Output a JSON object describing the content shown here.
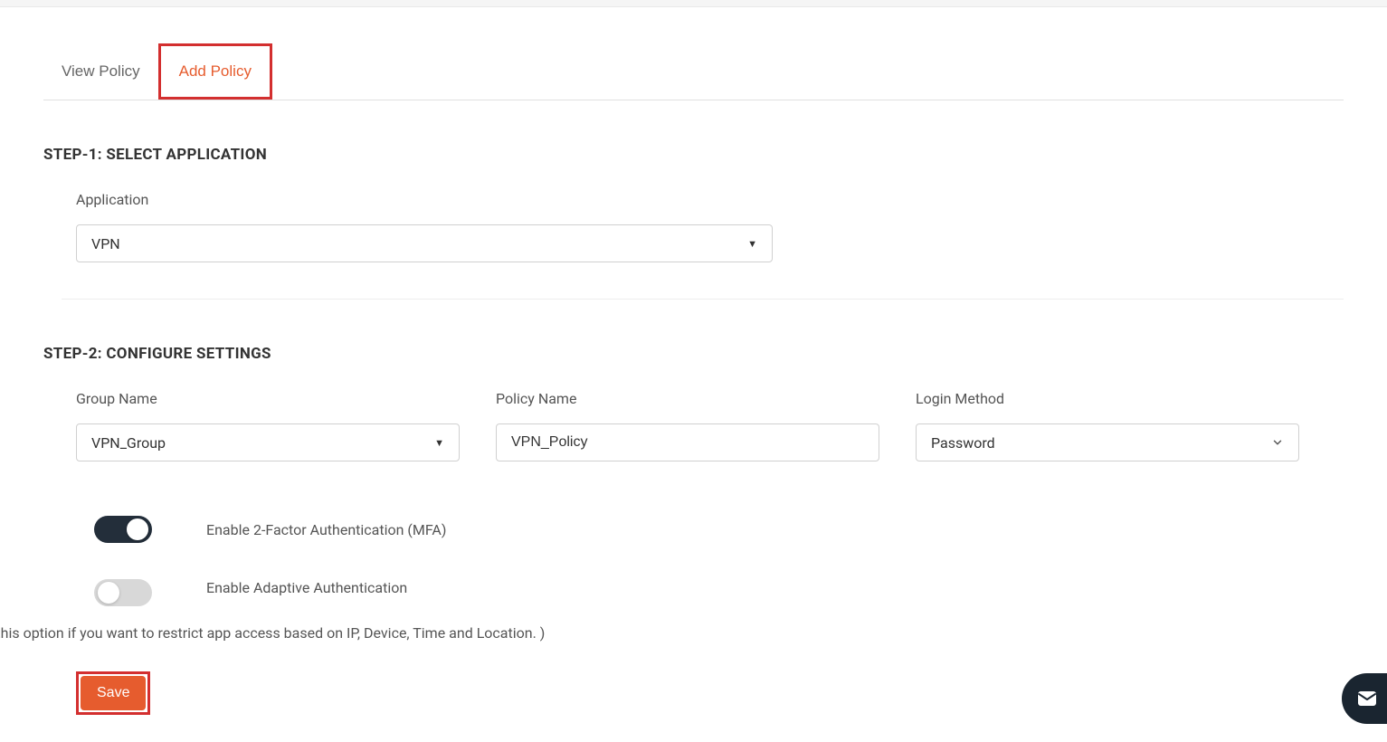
{
  "tabs": {
    "view_policy": "View Policy",
    "add_policy": "Add Policy"
  },
  "step1": {
    "title": "STEP-1: SELECT APPLICATION",
    "application_label": "Application",
    "application_value": "VPN"
  },
  "step2": {
    "title": "STEP-2: CONFIGURE SETTINGS",
    "group_name_label": "Group Name",
    "group_name_value": "VPN_Group",
    "policy_name_label": "Policy Name",
    "policy_name_value": "VPN_Policy",
    "login_method_label": "Login Method",
    "login_method_value": "Password"
  },
  "toggles": {
    "mfa_label": "Enable 2-Factor Authentication (MFA)",
    "adaptive_label": "Enable Adaptive Authentication",
    "adaptive_description": "( Enable this option if you want to restrict app access based on IP, Device, Time and Location. )"
  },
  "buttons": {
    "save": "Save"
  }
}
